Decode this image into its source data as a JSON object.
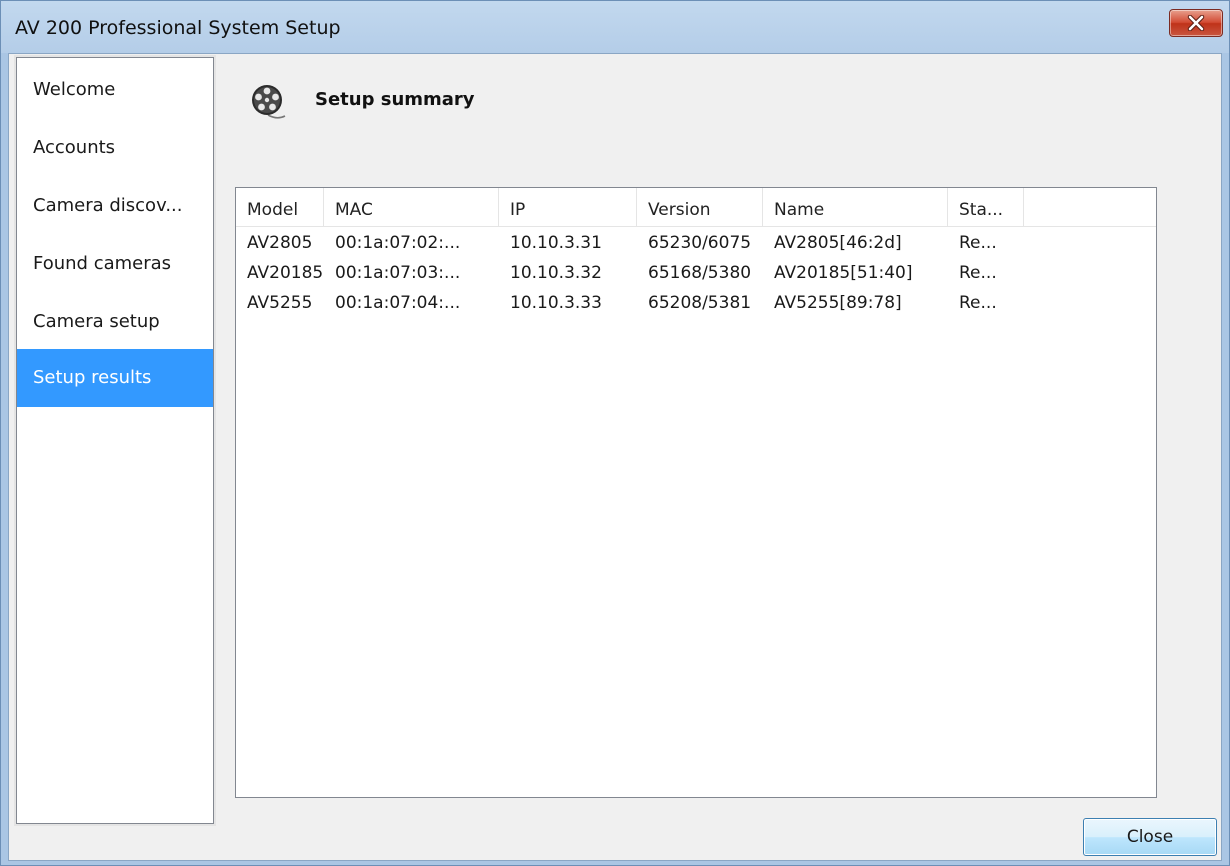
{
  "window": {
    "title": "AV 200 Professional System Setup"
  },
  "sidebar": {
    "items": [
      {
        "label": "Welcome",
        "active": false
      },
      {
        "label": "Accounts",
        "active": false
      },
      {
        "label": "Camera discov...",
        "active": false
      },
      {
        "label": "Found cameras",
        "active": false
      },
      {
        "label": "Camera setup",
        "active": false
      },
      {
        "label": "Setup results",
        "active": true
      }
    ]
  },
  "header": {
    "icon": "film-reel-icon",
    "title": "Setup summary"
  },
  "table": {
    "columns": [
      "Model",
      "MAC",
      "IP",
      "Version",
      "Name",
      "Sta..."
    ],
    "rows": [
      [
        "AV2805",
        "00:1a:07:02:...",
        "10.10.3.31",
        "65230/6075",
        "AV2805[46:2d]",
        "Re..."
      ],
      [
        "AV20185",
        "00:1a:07:03:...",
        "10.10.3.32",
        "65168/5380",
        "AV20185[51:40]",
        "Re..."
      ],
      [
        "AV5255",
        "00:1a:07:04:...",
        "10.10.3.33",
        "65208/5381",
        "AV5255[89:78]",
        "Re..."
      ]
    ]
  },
  "footer": {
    "close_label": "Close"
  },
  "colors": {
    "selection": "#3399ff",
    "title_bar": "#b9d1ea",
    "close_button": "#c9452d"
  }
}
